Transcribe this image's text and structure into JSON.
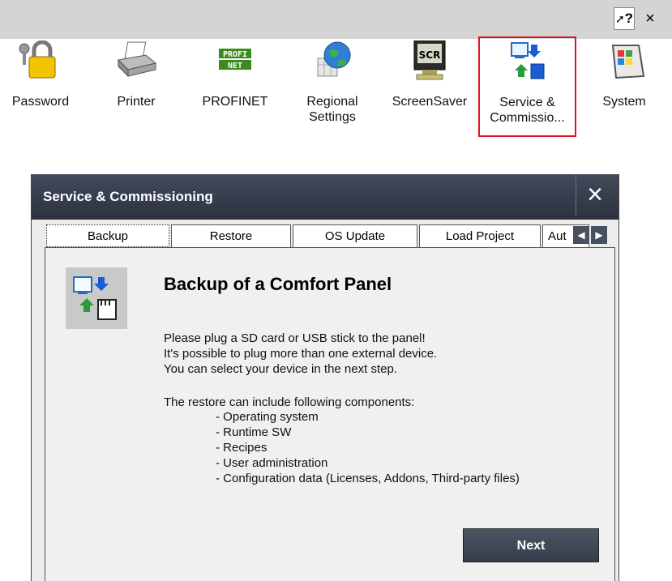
{
  "topbar": {
    "help_label": "?",
    "close_label": "×"
  },
  "control_panel": {
    "items": [
      {
        "label": "Password",
        "icon": "lock-icon"
      },
      {
        "label": "Printer",
        "icon": "printer-icon"
      },
      {
        "label": "PROFINET",
        "icon": "profinet-icon",
        "logo_text_1": "PROFI",
        "logo_text_2": "NET"
      },
      {
        "label": "Regional\nSettings",
        "icon": "globe-icon"
      },
      {
        "label": "ScreenSaver",
        "icon": "monitor-icon",
        "monitor_text": "SCR"
      },
      {
        "label": "Service &\nCommissio...",
        "icon": "service-icon",
        "selected": true
      },
      {
        "label": "System",
        "icon": "system-icon"
      }
    ]
  },
  "dialog": {
    "title": "Service & Commissioning",
    "close_label": "×",
    "tabs": [
      {
        "label": "Backup",
        "active": true
      },
      {
        "label": "Restore"
      },
      {
        "label": "OS Update"
      },
      {
        "label": "Load Project"
      },
      {
        "label": "Aut"
      }
    ],
    "heading": "Backup of a Comfort Panel",
    "para1": [
      "Please plug a SD card or USB stick to the panel!",
      "It's possible to plug more than one external device.",
      "You can select your device in the next step."
    ],
    "para2": "The restore can include following components:",
    "components": [
      "- Operating system",
      "- Runtime SW",
      "- Recipes",
      "- User administration",
      "- Configuration data (Licenses, Addons, Third-party files)"
    ],
    "next_label": "Next"
  },
  "colors": {
    "selection_border": "#e0141e",
    "title_bar": "#2b3240",
    "accent_blue": "#1a5bd6",
    "accent_green": "#2a9a3a"
  }
}
